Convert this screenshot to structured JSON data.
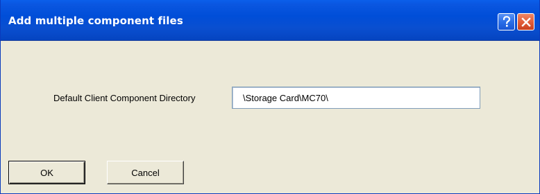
{
  "window": {
    "title": "Add multiple component files"
  },
  "titlebar_buttons": {
    "help_label": "?",
    "close_label": "✕"
  },
  "form": {
    "directory_label": "Default Client Component Directory",
    "directory_value": "\\Storage Card\\MC70\\"
  },
  "buttons": {
    "ok_label": "OK",
    "cancel_label": "Cancel"
  },
  "colors": {
    "titlebar": "#0054e3",
    "dialog_background": "#ece9d8",
    "close_button": "#e25e3a",
    "help_button": "#2b6fe8"
  },
  "icons": {
    "help": "help-icon",
    "close": "close-icon"
  }
}
